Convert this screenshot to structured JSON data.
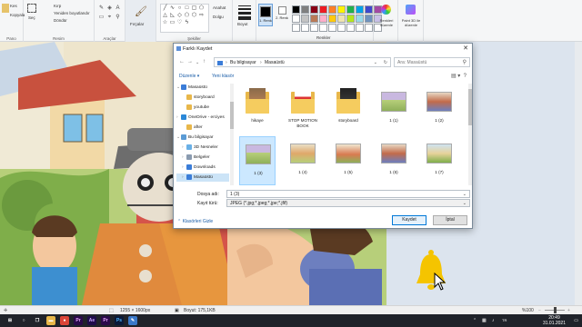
{
  "ribbon": {
    "clipboard": {
      "cut": "Kes",
      "copy": "Kopyala",
      "label": "Pano"
    },
    "image": {
      "select": "Seç",
      "crop": "Kırp",
      "resize": "Yeniden boyutlandır",
      "rotate": "Döndür",
      "label": "Resim"
    },
    "tools": {
      "label": "Araçlar"
    },
    "brushes": {
      "label": "Fırçalar"
    },
    "shapes": {
      "outline": "Anahat",
      "fill": "Dolgu",
      "label": "Şekiller"
    },
    "size_label": "Boyut",
    "color1": {
      "label": "1.\nRenk",
      "value": "#000000"
    },
    "color2": {
      "label": "2.\nRenk",
      "value": "#ffffff"
    },
    "edit_colors": "Renkleri düzenle",
    "paint3d": "Paint 3D ile düzenle",
    "colors_label": "Renkler",
    "palette": [
      "#000000",
      "#7f7f7f",
      "#880015",
      "#ed1c24",
      "#ff7f27",
      "#fff200",
      "#22b14c",
      "#00a2e8",
      "#3f48cc",
      "#a349a4",
      "#ffffff",
      "#c3c3c3",
      "#b97a57",
      "#ffaec9",
      "#ffc90e",
      "#efe4b0",
      "#b5e61d",
      "#99d9ea",
      "#7092be",
      "#c8bfe7",
      "#ffffff",
      "#ffffff",
      "#ffffff",
      "#ffffff",
      "#ffffff",
      "#ffffff",
      "#ffffff",
      "#ffffff",
      "#ffffff",
      "#ffffff"
    ]
  },
  "dialog": {
    "title": "Farklı Kaydet",
    "address": {
      "root": "Bu bilgisayar",
      "sep": "›",
      "current": "Masaüstü"
    },
    "search_placeholder": "Ara: Masaüstü",
    "organize": "Düzenle ▾",
    "new_folder": "Yeni klasör",
    "nav": [
      {
        "label": "Masaüstü",
        "color": "#3b7dd8"
      },
      {
        "label": "storyboard",
        "color": "#e8b74a"
      },
      {
        "label": "youtube",
        "color": "#e8b74a"
      },
      {
        "label": "OneDrive - erciyes",
        "color": "#2b88d8"
      },
      {
        "label": "after",
        "color": "#e8b74a"
      },
      {
        "label": "Bu bilgisayar",
        "color": "#5b9bd5"
      },
      {
        "label": "3D Nesneler",
        "color": "#6ab0e6"
      },
      {
        "label": "Belgeler",
        "color": "#8a9bb0"
      },
      {
        "label": "Downloads",
        "color": "#3b7dd8"
      },
      {
        "label": "Masaüstü",
        "color": "#3b7dd8"
      }
    ],
    "files": [
      {
        "label": "hikaye",
        "kind": "folder-photo"
      },
      {
        "label": "STOP MOTION BOOK",
        "kind": "folder-paper"
      },
      {
        "label": "storyboard",
        "kind": "folder-dark"
      },
      {
        "label": "1 (1)",
        "kind": "photo-a"
      },
      {
        "label": "1 (2)",
        "kind": "photo-b"
      },
      {
        "label": "1 (3)",
        "kind": "photo-a"
      },
      {
        "label": "1 (4)",
        "kind": "photo-c"
      },
      {
        "label": "1 (5)",
        "kind": "photo-d"
      },
      {
        "label": "1 (6)",
        "kind": "photo-b"
      },
      {
        "label": "1 (7)",
        "kind": "photo-e"
      }
    ],
    "filename_label": "Dosya adı:",
    "filename_value": "1 (3)",
    "filetype_label": "Kayıt türü:",
    "filetype_value": "JPEG (*.jpg;*.jpeg;*.jpe;*.jfif)",
    "hide_folders": "Klasörleri Gizle",
    "save": "Kaydet",
    "cancel": "İptal"
  },
  "status": {
    "dimensions": "1255 × 1600px",
    "size": "Boyut: 175,1KB",
    "zoom": "%100"
  },
  "taskbar": {
    "time": "20:49",
    "date": "31.01.2021",
    "apps": [
      {
        "name": "windows",
        "glyph": "⊞",
        "color": "#20232a"
      },
      {
        "name": "search",
        "glyph": "○",
        "color": "#20232a"
      },
      {
        "name": "taskview",
        "glyph": "❐",
        "color": "#20232a"
      },
      {
        "name": "explorer",
        "glyph": "▬",
        "color": "#e8b74a"
      },
      {
        "name": "chrome",
        "glyph": "●",
        "color": "#db4437"
      },
      {
        "name": "premiere",
        "glyph": "Pr",
        "color": "#2a0a4a"
      },
      {
        "name": "aftereffects",
        "glyph": "Ae",
        "color": "#1f0c4a"
      },
      {
        "name": "premiere2",
        "glyph": "Pr",
        "color": "#2a0a4a"
      },
      {
        "name": "photoshop",
        "glyph": "Ps",
        "color": "#0a1a3a"
      },
      {
        "name": "paint",
        "glyph": "✎",
        "color": "#3a78c8"
      }
    ]
  }
}
